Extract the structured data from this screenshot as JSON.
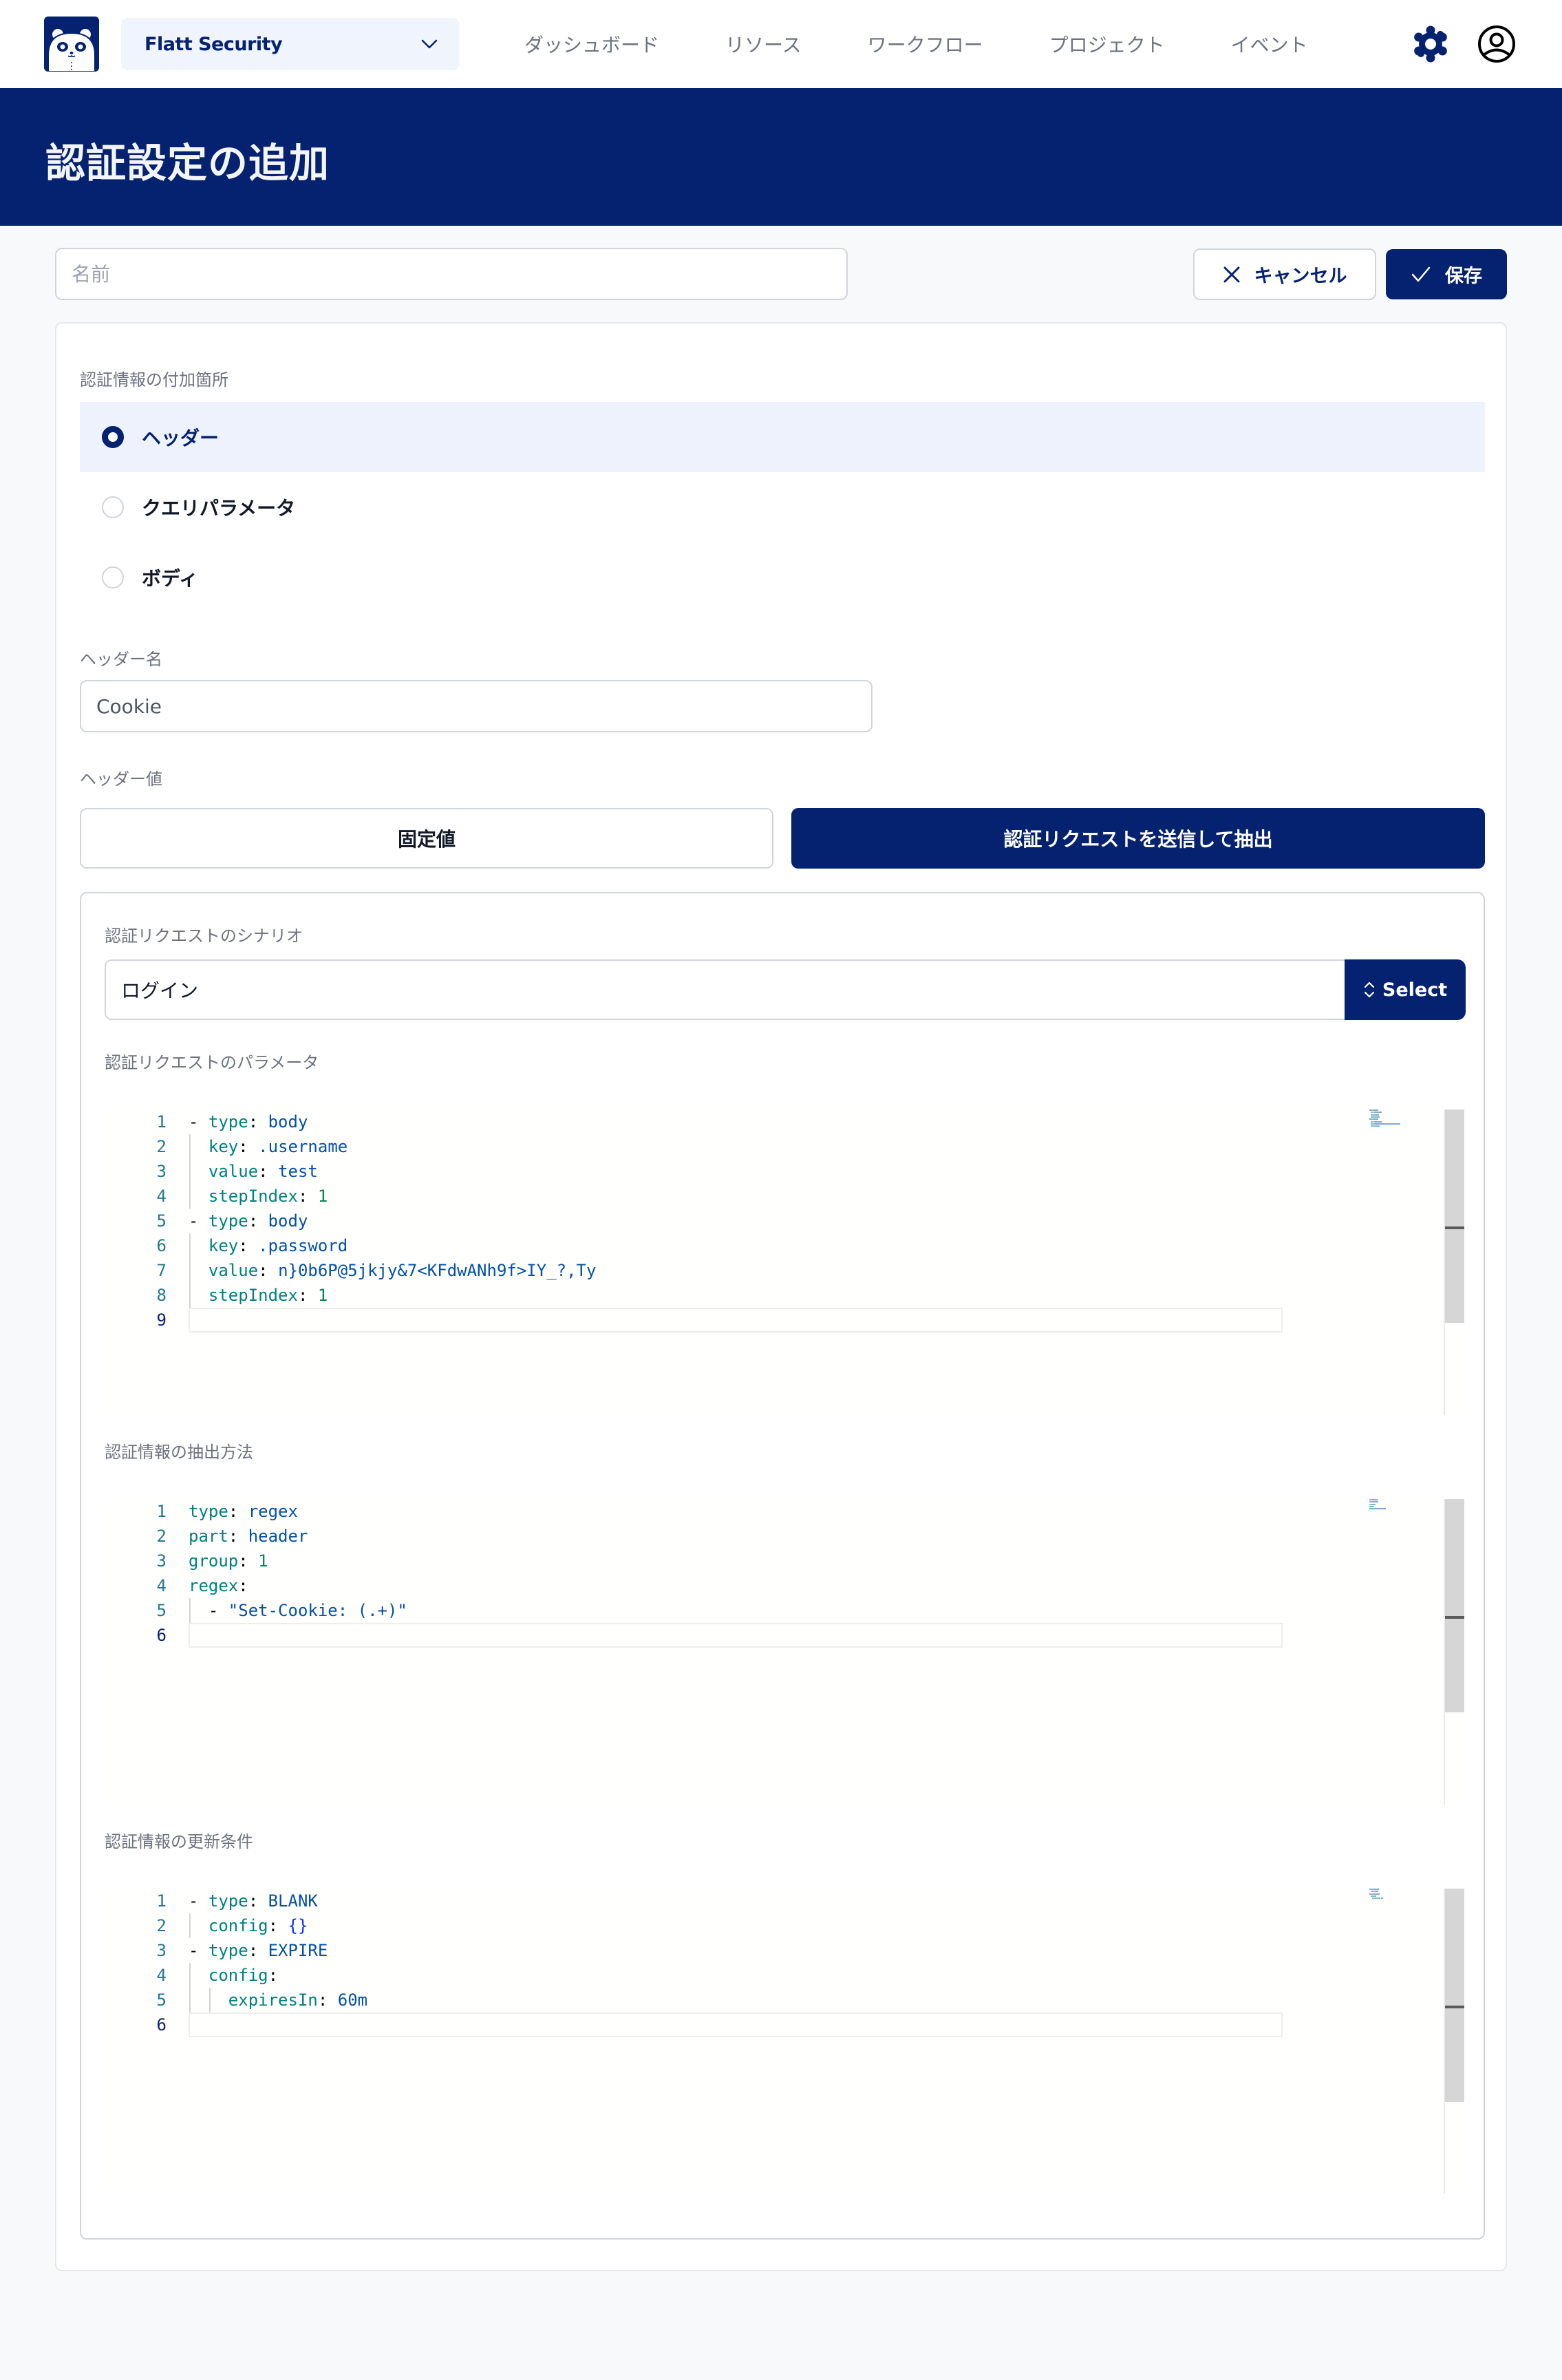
{
  "colors": {
    "brand": "#04226f",
    "selected_row_bg": "#eef2fd",
    "page_bg": "#f8f9fb"
  },
  "nav": {
    "logo_icon": "panda-logo-icon",
    "org_selector": {
      "value": "Flatt Security",
      "icon": "chevron-down-icon"
    },
    "items": [
      {
        "label": "ダッシュボード"
      },
      {
        "label": "リソース"
      },
      {
        "label": "ワークフロー"
      },
      {
        "label": "プロジェクト"
      },
      {
        "label": "イベント"
      }
    ],
    "settings_icon": "gear-icon",
    "account_icon": "user-circle-icon"
  },
  "header": {
    "title": "認証設定の追加"
  },
  "form": {
    "name_placeholder": "名前",
    "name_value": "",
    "cancel_label": "キャンセル",
    "save_label": "保存"
  },
  "attach_location": {
    "label": "認証情報の付加箇所",
    "options": [
      {
        "label": "ヘッダー",
        "selected": true
      },
      {
        "label": "クエリパラメータ",
        "selected": false
      },
      {
        "label": "ボディ",
        "selected": false
      }
    ]
  },
  "header_name": {
    "label": "ヘッダー名",
    "value": "Cookie"
  },
  "header_value": {
    "label": "ヘッダー値",
    "modes": [
      {
        "label": "固定値",
        "active": false
      },
      {
        "label": "認証リクエストを送信して抽出",
        "active": true
      }
    ]
  },
  "auth_request": {
    "scenario_label": "認証リクエストのシナリオ",
    "scenario_value": "ログイン",
    "select_label": "Select",
    "params_label": "認証リクエストのパラメータ",
    "extract_label": "認証情報の抽出方法",
    "refresh_label": "認証情報の更新条件"
  },
  "editors": {
    "params": {
      "active_line": 9,
      "lines": [
        [
          [
            "- ",
            "punc"
          ],
          [
            "type",
            "key"
          ],
          [
            ": ",
            "punc"
          ],
          [
            "body",
            "val"
          ]
        ],
        [
          [
            "  ",
            "punc"
          ],
          [
            "key",
            "key"
          ],
          [
            ": ",
            "punc"
          ],
          [
            ".username",
            "val"
          ]
        ],
        [
          [
            "  ",
            "punc"
          ],
          [
            "value",
            "key"
          ],
          [
            ": ",
            "punc"
          ],
          [
            "test",
            "val"
          ]
        ],
        [
          [
            "  ",
            "punc"
          ],
          [
            "stepIndex",
            "key"
          ],
          [
            ": ",
            "punc"
          ],
          [
            "1",
            "num"
          ]
        ],
        [
          [
            "- ",
            "punc"
          ],
          [
            "type",
            "key"
          ],
          [
            ": ",
            "punc"
          ],
          [
            "body",
            "val"
          ]
        ],
        [
          [
            "  ",
            "punc"
          ],
          [
            "key",
            "key"
          ],
          [
            ": ",
            "punc"
          ],
          [
            ".password",
            "val"
          ]
        ],
        [
          [
            "  ",
            "punc"
          ],
          [
            "value",
            "key"
          ],
          [
            ": ",
            "punc"
          ],
          [
            "n}0b6P@5jkjy&7<KFdwANh9f>IY_?,Ty",
            "val"
          ]
        ],
        [
          [
            "  ",
            "punc"
          ],
          [
            "stepIndex",
            "key"
          ],
          [
            ": ",
            "punc"
          ],
          [
            "1",
            "num"
          ]
        ],
        []
      ]
    },
    "extract": {
      "active_line": 6,
      "lines": [
        [
          [
            "type",
            "key"
          ],
          [
            ": ",
            "punc"
          ],
          [
            "regex",
            "val"
          ]
        ],
        [
          [
            "part",
            "key"
          ],
          [
            ": ",
            "punc"
          ],
          [
            "header",
            "val"
          ]
        ],
        [
          [
            "group",
            "key"
          ],
          [
            ": ",
            "punc"
          ],
          [
            "1",
            "num"
          ]
        ],
        [
          [
            "regex",
            "key"
          ],
          [
            ":",
            "punc"
          ]
        ],
        [
          [
            "  - ",
            "punc"
          ],
          [
            "\"Set-Cookie: (.+)\"",
            "val"
          ]
        ],
        []
      ]
    },
    "refresh": {
      "active_line": 6,
      "lines": [
        [
          [
            "- ",
            "punc"
          ],
          [
            "type",
            "key"
          ],
          [
            ": ",
            "punc"
          ],
          [
            "BLANK",
            "val"
          ]
        ],
        [
          [
            "  ",
            "punc"
          ],
          [
            "config",
            "key"
          ],
          [
            ": ",
            "punc"
          ],
          [
            "{}",
            "brace"
          ]
        ],
        [
          [
            "- ",
            "punc"
          ],
          [
            "type",
            "key"
          ],
          [
            ": ",
            "punc"
          ],
          [
            "EXPIRE",
            "val"
          ]
        ],
        [
          [
            "  ",
            "punc"
          ],
          [
            "config",
            "key"
          ],
          [
            ":",
            "punc"
          ]
        ],
        [
          [
            "    ",
            "punc"
          ],
          [
            "expiresIn",
            "key"
          ],
          [
            ": ",
            "punc"
          ],
          [
            "60m",
            "val"
          ]
        ],
        []
      ]
    }
  }
}
